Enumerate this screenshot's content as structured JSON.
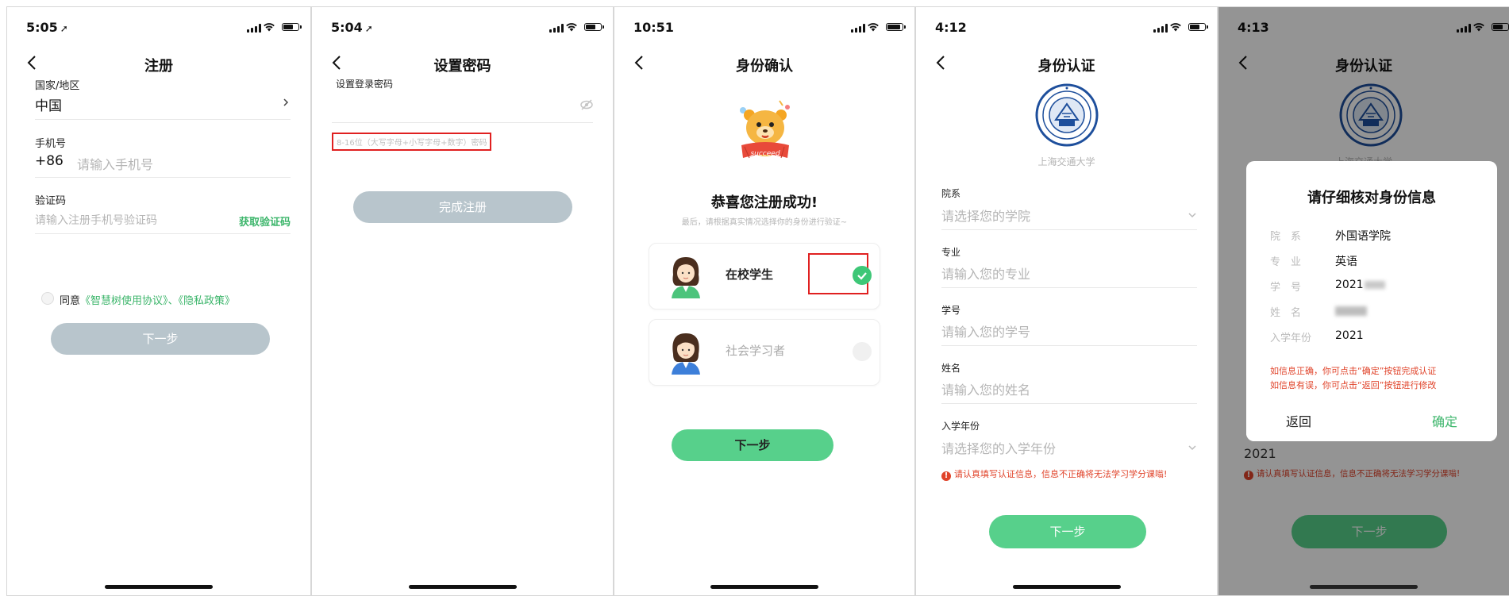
{
  "screens": [
    {
      "time": "5:05",
      "title": "注册",
      "country_label": "国家/地区",
      "country_value": "中国",
      "phone_label": "手机号",
      "phone_prefix": "+86",
      "phone_placeholder": "请输入手机号",
      "code_label": "验证码",
      "code_placeholder": "请输入注册手机号验证码",
      "get_code": "获取验证码",
      "agree_prefix": "同意",
      "agree_links": "《智慧树使用协议》、《隐私政策》",
      "next_button": "下一步"
    },
    {
      "time": "5:04",
      "title": "设置密码",
      "password_label": "设置登录密码",
      "password_hint": "8-16位（大写字母+小写字母+数字）密码",
      "submit_button": "完成注册"
    },
    {
      "time": "10:51",
      "title": "身份确认",
      "badge_text": "succeed",
      "congrats": "恭喜您注册成功!",
      "subtitle": "最后，请根据真实情况选择你的身份进行验证~",
      "option_student": "在校学生",
      "option_social": "社会学习者",
      "next_button": "下一步"
    },
    {
      "time": "4:12",
      "title": "身份认证",
      "university": "上海交通大学",
      "fields": [
        {
          "label": "院系",
          "placeholder": "请选择您的学院"
        },
        {
          "label": "专业",
          "placeholder": "请输入您的专业"
        },
        {
          "label": "学号",
          "placeholder": "请输入您的学号"
        },
        {
          "label": "姓名",
          "placeholder": "请输入您的姓名"
        },
        {
          "label": "入学年份",
          "placeholder": "请选择您的入学年份"
        }
      ],
      "warning": "请认真填写认证信息，信息不正确将无法学习学分课嗡!",
      "next_button": "下一步"
    },
    {
      "time": "4:13",
      "title": "身份认证",
      "university": "上海交通大学",
      "modal": {
        "title": "请仔细核对身份信息",
        "rows": [
          {
            "key": "院　系",
            "value": "外国语学院"
          },
          {
            "key": "专　业",
            "value": "英语"
          },
          {
            "key": "学　号",
            "value": "2021"
          },
          {
            "key": "姓　名",
            "value": ""
          },
          {
            "key": "入学年份",
            "value": "2021"
          }
        ],
        "note1": "如信息正确，你可点击“确定”按钮完成认证",
        "note2": "如信息有误，你可点击“返回”按钮进行修改",
        "back": "返回",
        "confirm": "确定"
      },
      "bg_year": "2021",
      "warning": "请认真填写认证信息，信息不正确将无法学习学分课嗡!",
      "next_button": "下一步"
    }
  ],
  "colors": {
    "accent_green": "#3bb56a",
    "button_green": "#57d08b",
    "button_gray": "#b8c5cc",
    "warning_red": "#e0432a",
    "highlight_red": "#e02020"
  }
}
